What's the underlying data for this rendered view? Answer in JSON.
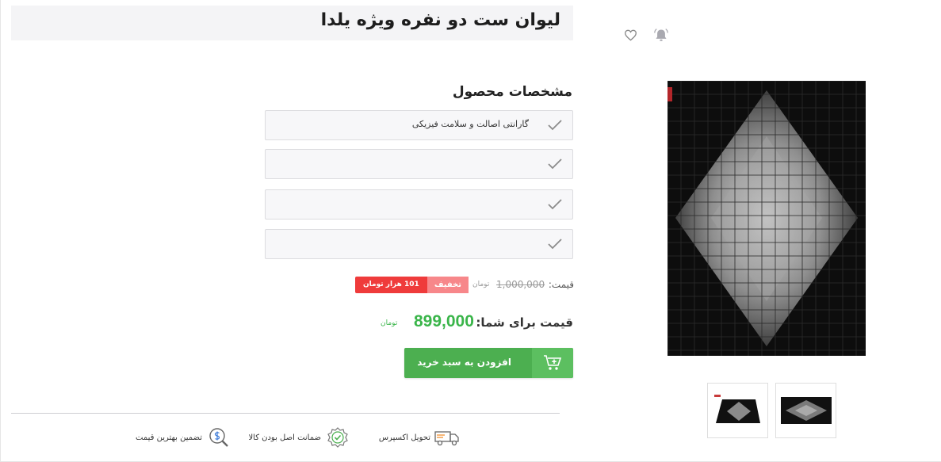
{
  "product": {
    "title": "لیوان ست دو نفره ویژه یلدا"
  },
  "actions": {
    "wishlist_icon": "heart-icon",
    "notify_icon": "bell-icon"
  },
  "specs": {
    "heading": "مشخصات محصول",
    "items": [
      {
        "text": "گارانتی اصالت و سلامت فیزیکی"
      },
      {
        "text": ""
      },
      {
        "text": ""
      },
      {
        "text": ""
      }
    ]
  },
  "pricing": {
    "price_label": "قیمت:",
    "old_price": "1,000,000",
    "old_currency": "تومان",
    "discount_label": "تخفیف",
    "discount_amount": "101 هزار تومان",
    "final_label": "قیمت برای شما:",
    "final_price": "899,000",
    "final_currency": "تومان"
  },
  "cart": {
    "add_label": "افزودن به سبد خرید",
    "icon": "cart-add-icon"
  },
  "features": [
    {
      "label": "تحویل اکسپرس",
      "icon": "truck-icon"
    },
    {
      "label": "ضمانت اصل بودن کالا",
      "icon": "badge-check-icon"
    },
    {
      "label": "تضمین بهترین قیمت",
      "icon": "price-search-icon"
    }
  ],
  "gallery": {
    "thumbnails": 2
  },
  "colors": {
    "accent_green": "#3ab54a",
    "button_green": "#4caf50",
    "discount_red": "#ef3b3b",
    "discount_pink": "#f7878a"
  }
}
